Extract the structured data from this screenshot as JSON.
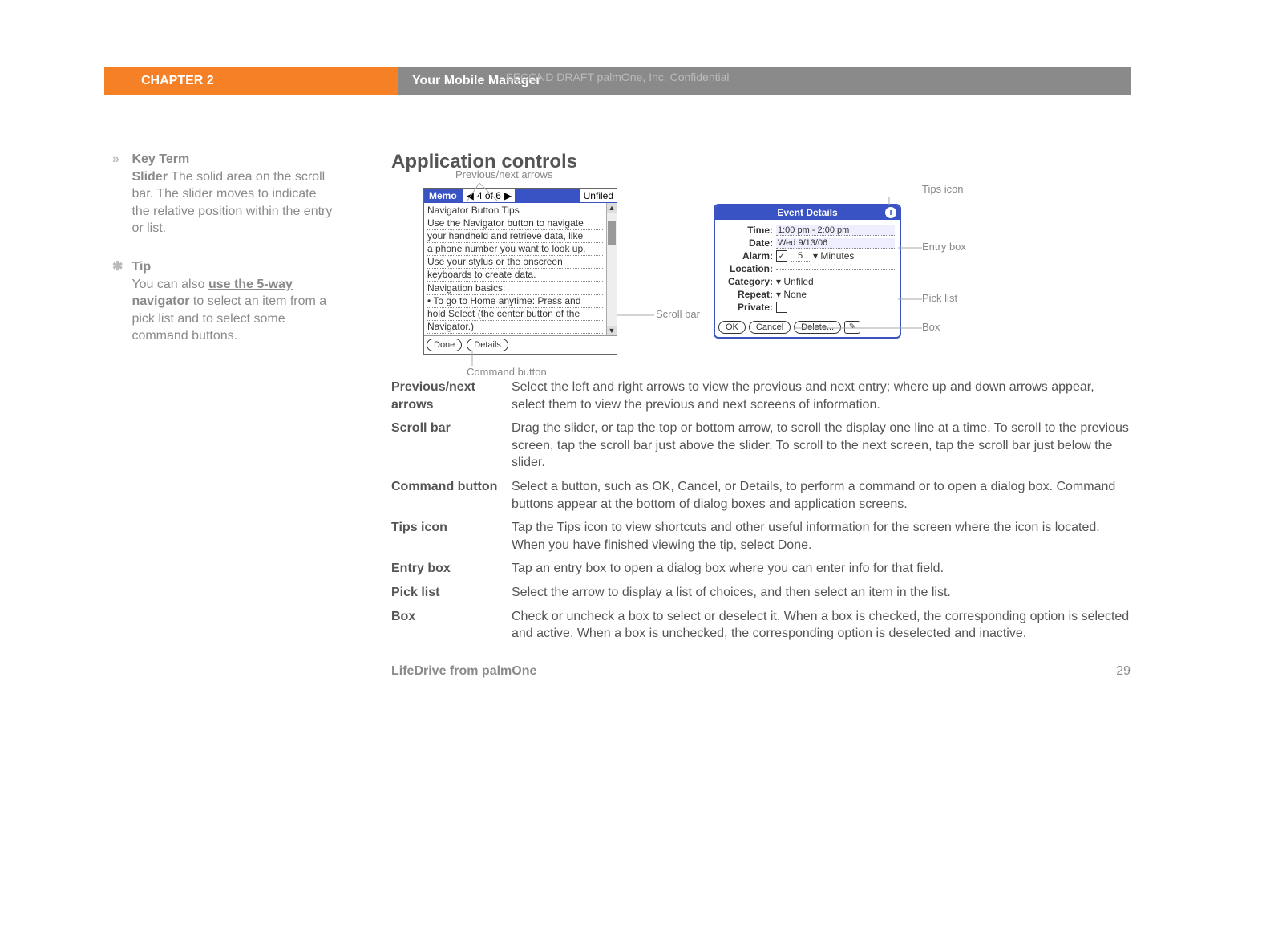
{
  "meta": {
    "top_note": "SECOND DRAFT palmOne, Inc.  Confidential",
    "chapter_label": "CHAPTER 2",
    "chapter_title": "Your Mobile Manager",
    "footer_product": "LifeDrive from palmOne",
    "page_number": "29"
  },
  "sidebar": {
    "keyterm": {
      "heading": "Key Term",
      "term": "Slider",
      "text": "The solid area on the scroll bar. The slider moves to indicate the relative position within the entry or list."
    },
    "tip": {
      "heading": "Tip",
      "before": "You can also ",
      "link": "use the 5-way navigator",
      "after": " to select an item from a pick list and to select some command buttons."
    }
  },
  "main": {
    "section_title": "Application controls",
    "callouts": {
      "prevnext": "Previous/next arrows",
      "scrollbar": "Scroll bar",
      "commandbtn": "Command button",
      "tipsicon": "Tips icon",
      "entrybox": "Entry box",
      "picklist": "Pick list",
      "box": "Box"
    },
    "memo": {
      "title": "Memo",
      "idx": "4 of 6",
      "category": "Unfiled",
      "lines": [
        "Navigator Button Tips",
        "Use the Navigator button to navigate",
        "your handheld and retrieve data, like",
        "a phone number you want to look up.",
        "Use your stylus or the onscreen",
        "keyboards to create data.",
        "",
        "Navigation basics:",
        "• To go to Home anytime: Press and",
        "hold Select (the center button of the",
        "Navigator.)"
      ],
      "buttons": {
        "done": "Done",
        "details": "Details"
      }
    },
    "event": {
      "title": "Event Details",
      "tips_glyph": "i",
      "rows": {
        "time_label": "Time:",
        "time_value": "1:00 pm - 2:00 pm",
        "date_label": "Date:",
        "date_value": "Wed 9/13/06",
        "alarm_label": "Alarm:",
        "alarm_value": "5",
        "alarm_unit": "Minutes",
        "location_label": "Location:",
        "location_value": "",
        "category_label": "Category:",
        "category_value": "Unfiled",
        "repeat_label": "Repeat:",
        "repeat_value": "None",
        "private_label": "Private:"
      },
      "buttons": {
        "ok": "OK",
        "cancel": "Cancel",
        "delete": "Delete...",
        "note": "✎"
      }
    },
    "definitions": [
      {
        "term": "Previous/next arrows",
        "desc": "Select the left and right arrows to view the previous and next entry; where up and down arrows appear, select them to view the previous and next screens of information."
      },
      {
        "term": "Scroll bar",
        "desc": "Drag the slider, or tap the top or bottom arrow, to scroll the display one line at a time. To scroll to the previous screen, tap the scroll bar just above the slider. To scroll to the next screen, tap the scroll bar just below the slider."
      },
      {
        "term": "Command button",
        "desc": "Select a button, such as OK, Cancel, or Details, to perform a command or to open a dialog box. Command buttons appear at the bottom of dialog boxes and application screens."
      },
      {
        "term": "Tips icon",
        "desc": "Tap the Tips icon to view shortcuts and other useful information for the screen where the icon is located. When you have finished viewing the tip, select Done."
      },
      {
        "term": "Entry box",
        "desc": "Tap an entry box to open a dialog box where you can enter info for that field."
      },
      {
        "term": "Pick list",
        "desc": "Select the arrow to display a list of choices, and then select an item in the list."
      },
      {
        "term": "Box",
        "desc": "Check or uncheck a box to select or deselect it. When a box is checked, the corresponding option is selected and active. When a box is unchecked, the corresponding option is deselected and inactive."
      }
    ]
  }
}
